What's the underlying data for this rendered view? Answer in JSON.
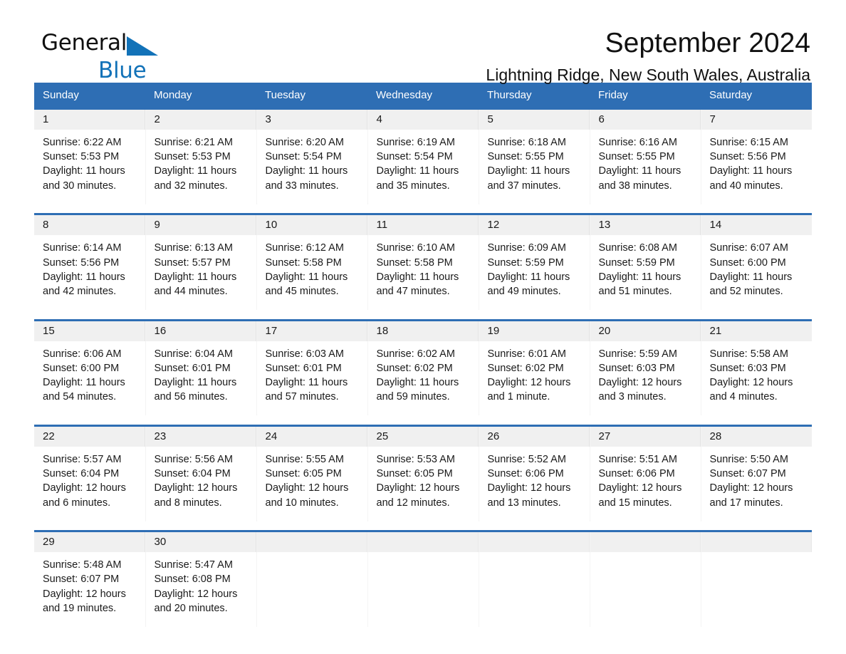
{
  "brand": {
    "name_part1": "General",
    "name_part2": "Blue",
    "triangle_color": "#1272b8"
  },
  "header": {
    "title": "September 2024",
    "location": "Lightning Ridge, New South Wales, Australia"
  },
  "theme": {
    "header_blue": "#2e6eb4",
    "daynum_gray": "#f0f0f0",
    "text": "#1a1a1a"
  },
  "weekday_headers": [
    "Sunday",
    "Monday",
    "Tuesday",
    "Wednesday",
    "Thursday",
    "Friday",
    "Saturday"
  ],
  "weeks": [
    [
      {
        "day": "1",
        "sunrise": "Sunrise: 6:22 AM",
        "sunset": "Sunset: 5:53 PM",
        "daylight": "Daylight: 11 hours and 30 minutes."
      },
      {
        "day": "2",
        "sunrise": "Sunrise: 6:21 AM",
        "sunset": "Sunset: 5:53 PM",
        "daylight": "Daylight: 11 hours and 32 minutes."
      },
      {
        "day": "3",
        "sunrise": "Sunrise: 6:20 AM",
        "sunset": "Sunset: 5:54 PM",
        "daylight": "Daylight: 11 hours and 33 minutes."
      },
      {
        "day": "4",
        "sunrise": "Sunrise: 6:19 AM",
        "sunset": "Sunset: 5:54 PM",
        "daylight": "Daylight: 11 hours and 35 minutes."
      },
      {
        "day": "5",
        "sunrise": "Sunrise: 6:18 AM",
        "sunset": "Sunset: 5:55 PM",
        "daylight": "Daylight: 11 hours and 37 minutes."
      },
      {
        "day": "6",
        "sunrise": "Sunrise: 6:16 AM",
        "sunset": "Sunset: 5:55 PM",
        "daylight": "Daylight: 11 hours and 38 minutes."
      },
      {
        "day": "7",
        "sunrise": "Sunrise: 6:15 AM",
        "sunset": "Sunset: 5:56 PM",
        "daylight": "Daylight: 11 hours and 40 minutes."
      }
    ],
    [
      {
        "day": "8",
        "sunrise": "Sunrise: 6:14 AM",
        "sunset": "Sunset: 5:56 PM",
        "daylight": "Daylight: 11 hours and 42 minutes."
      },
      {
        "day": "9",
        "sunrise": "Sunrise: 6:13 AM",
        "sunset": "Sunset: 5:57 PM",
        "daylight": "Daylight: 11 hours and 44 minutes."
      },
      {
        "day": "10",
        "sunrise": "Sunrise: 6:12 AM",
        "sunset": "Sunset: 5:58 PM",
        "daylight": "Daylight: 11 hours and 45 minutes."
      },
      {
        "day": "11",
        "sunrise": "Sunrise: 6:10 AM",
        "sunset": "Sunset: 5:58 PM",
        "daylight": "Daylight: 11 hours and 47 minutes."
      },
      {
        "day": "12",
        "sunrise": "Sunrise: 6:09 AM",
        "sunset": "Sunset: 5:59 PM",
        "daylight": "Daylight: 11 hours and 49 minutes."
      },
      {
        "day": "13",
        "sunrise": "Sunrise: 6:08 AM",
        "sunset": "Sunset: 5:59 PM",
        "daylight": "Daylight: 11 hours and 51 minutes."
      },
      {
        "day": "14",
        "sunrise": "Sunrise: 6:07 AM",
        "sunset": "Sunset: 6:00 PM",
        "daylight": "Daylight: 11 hours and 52 minutes."
      }
    ],
    [
      {
        "day": "15",
        "sunrise": "Sunrise: 6:06 AM",
        "sunset": "Sunset: 6:00 PM",
        "daylight": "Daylight: 11 hours and 54 minutes."
      },
      {
        "day": "16",
        "sunrise": "Sunrise: 6:04 AM",
        "sunset": "Sunset: 6:01 PM",
        "daylight": "Daylight: 11 hours and 56 minutes."
      },
      {
        "day": "17",
        "sunrise": "Sunrise: 6:03 AM",
        "sunset": "Sunset: 6:01 PM",
        "daylight": "Daylight: 11 hours and 57 minutes."
      },
      {
        "day": "18",
        "sunrise": "Sunrise: 6:02 AM",
        "sunset": "Sunset: 6:02 PM",
        "daylight": "Daylight: 11 hours and 59 minutes."
      },
      {
        "day": "19",
        "sunrise": "Sunrise: 6:01 AM",
        "sunset": "Sunset: 6:02 PM",
        "daylight": "Daylight: 12 hours and 1 minute."
      },
      {
        "day": "20",
        "sunrise": "Sunrise: 5:59 AM",
        "sunset": "Sunset: 6:03 PM",
        "daylight": "Daylight: 12 hours and 3 minutes."
      },
      {
        "day": "21",
        "sunrise": "Sunrise: 5:58 AM",
        "sunset": "Sunset: 6:03 PM",
        "daylight": "Daylight: 12 hours and 4 minutes."
      }
    ],
    [
      {
        "day": "22",
        "sunrise": "Sunrise: 5:57 AM",
        "sunset": "Sunset: 6:04 PM",
        "daylight": "Daylight: 12 hours and 6 minutes."
      },
      {
        "day": "23",
        "sunrise": "Sunrise: 5:56 AM",
        "sunset": "Sunset: 6:04 PM",
        "daylight": "Daylight: 12 hours and 8 minutes."
      },
      {
        "day": "24",
        "sunrise": "Sunrise: 5:55 AM",
        "sunset": "Sunset: 6:05 PM",
        "daylight": "Daylight: 12 hours and 10 minutes."
      },
      {
        "day": "25",
        "sunrise": "Sunrise: 5:53 AM",
        "sunset": "Sunset: 6:05 PM",
        "daylight": "Daylight: 12 hours and 12 minutes."
      },
      {
        "day": "26",
        "sunrise": "Sunrise: 5:52 AM",
        "sunset": "Sunset: 6:06 PM",
        "daylight": "Daylight: 12 hours and 13 minutes."
      },
      {
        "day": "27",
        "sunrise": "Sunrise: 5:51 AM",
        "sunset": "Sunset: 6:06 PM",
        "daylight": "Daylight: 12 hours and 15 minutes."
      },
      {
        "day": "28",
        "sunrise": "Sunrise: 5:50 AM",
        "sunset": "Sunset: 6:07 PM",
        "daylight": "Daylight: 12 hours and 17 minutes."
      }
    ],
    [
      {
        "day": "29",
        "sunrise": "Sunrise: 5:48 AM",
        "sunset": "Sunset: 6:07 PM",
        "daylight": "Daylight: 12 hours and 19 minutes."
      },
      {
        "day": "30",
        "sunrise": "Sunrise: 5:47 AM",
        "sunset": "Sunset: 6:08 PM",
        "daylight": "Daylight: 12 hours and 20 minutes."
      },
      {
        "day": "",
        "sunrise": "",
        "sunset": "",
        "daylight": ""
      },
      {
        "day": "",
        "sunrise": "",
        "sunset": "",
        "daylight": ""
      },
      {
        "day": "",
        "sunrise": "",
        "sunset": "",
        "daylight": ""
      },
      {
        "day": "",
        "sunrise": "",
        "sunset": "",
        "daylight": ""
      },
      {
        "day": "",
        "sunrise": "",
        "sunset": "",
        "daylight": ""
      }
    ]
  ]
}
